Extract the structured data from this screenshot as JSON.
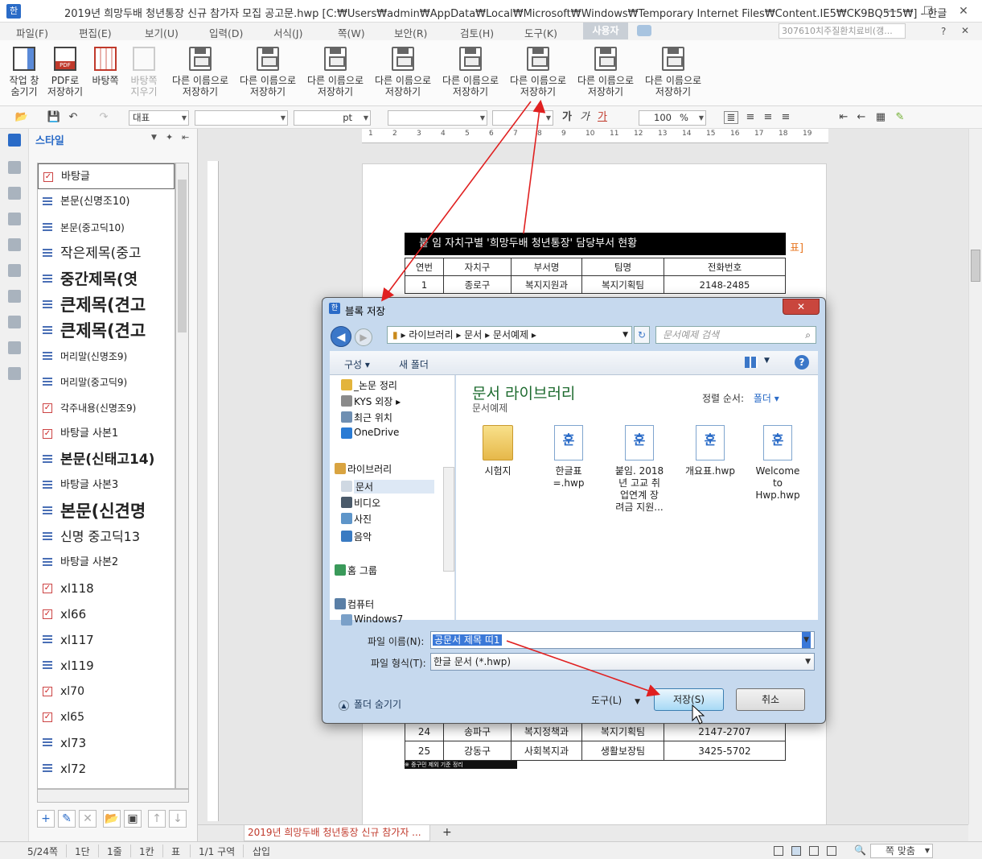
{
  "window": {
    "title": "2019년 희망두배 청년통장 신규 참가자 모집 공고문.hwp [C:₩Users₩admin₩AppData₩Local₩Microsoft₩Windows₩Temporary Internet Files₩Content.IE5₩CK9BQ515₩] - 한글",
    "minimize": "—",
    "maximize": "☐",
    "close": "✕"
  },
  "menu": {
    "items": [
      "파일(F)",
      "편집(E)",
      "보기(U)",
      "입력(D)",
      "서식(J)",
      "쪽(W)",
      "보안(R)",
      "검토(H)",
      "도구(K)"
    ],
    "user_tab": "사용자",
    "doc_combo": "307610치주질환치료비(갱...",
    "help": "?"
  },
  "ribbon": {
    "buttons": [
      "작업 창\n숨기기",
      "PDF로\n저장하기",
      "바탕쪽",
      "바탕쪽\n지우기",
      "다른 이름으로\n저장하기",
      "다른 이름으로\n저장하기",
      "다른 이름으로\n저장하기",
      "다른 이름으로\n저장하기",
      "다른 이름으로\n저장하기",
      "다른 이름으로\n저장하기",
      "다른 이름으로\n저장하기",
      "다른 이름으로\n저장하기"
    ]
  },
  "format_toolbar": {
    "style": "대표",
    "font": "",
    "size_unit": "pt",
    "zoom": "100",
    "zoom_unit": "%"
  },
  "style_panel": {
    "title": "스타일",
    "styles": [
      {
        "label": "바탕글",
        "icon": "mark"
      },
      {
        "label": "본문(신명조10)",
        "icon": "lines"
      },
      {
        "label": "본문(중고딕10)",
        "icon": "lines"
      },
      {
        "label": "작은제목(중고",
        "icon": "lines"
      },
      {
        "label": "중간제목(엿",
        "icon": "lines"
      },
      {
        "label": "큰제목(견고",
        "icon": "lines"
      },
      {
        "label": "큰제목(견고",
        "icon": "lines"
      },
      {
        "label": "머리말(신명조9)",
        "icon": "lines"
      },
      {
        "label": "머리말(중고딕9)",
        "icon": "lines"
      },
      {
        "label": "각주내용(신명조9)",
        "icon": "mark"
      },
      {
        "label": "바탕글 사본1",
        "icon": "mark"
      },
      {
        "label": "본문(신태고14)",
        "icon": "lines"
      },
      {
        "label": "바탕글 사본3",
        "icon": "lines"
      },
      {
        "label": "본문(신견명",
        "icon": "lines"
      },
      {
        "label": "신명 중고딕13",
        "icon": "lines"
      },
      {
        "label": "바탕글 사본2",
        "icon": "lines"
      },
      {
        "label": "xl118",
        "icon": "mark"
      },
      {
        "label": "xl66",
        "icon": "mark"
      },
      {
        "label": "xl117",
        "icon": "lines"
      },
      {
        "label": "xl119",
        "icon": "lines"
      },
      {
        "label": "xl70",
        "icon": "mark"
      },
      {
        "label": "xl65",
        "icon": "mark"
      },
      {
        "label": "xl73",
        "icon": "lines"
      },
      {
        "label": "xl72",
        "icon": "lines"
      }
    ]
  },
  "document": {
    "table_title": "붙 임  자치구별 '희망두배 청년통장' 담당부서 현황",
    "side_hint": "표]",
    "headers": [
      "연번",
      "자치구",
      "부서명",
      "팀명",
      "전화번호"
    ],
    "rows": [
      [
        "1",
        "종로구",
        "복지지원과",
        "복지기획팀",
        "2148-2485"
      ]
    ],
    "bottom_rows": [
      [
        "24",
        "송파구",
        "복지정책과",
        "복지기획팀",
        "2147-2707"
      ],
      [
        "25",
        "강동구",
        "사회복지과",
        "생활보장팀",
        "3425-5702"
      ]
    ],
    "footnote": "※ 중구민 제외 기준 정리"
  },
  "ruler": {
    "ticks": [
      "1",
      "2",
      "3",
      "4",
      "5",
      "6",
      "7",
      "8",
      "9",
      "10",
      "11",
      "12",
      "13",
      "14",
      "15",
      "16",
      "17",
      "18",
      "19"
    ]
  },
  "dialog": {
    "title": "블록 저장",
    "address": [
      "라이브러리",
      "문서",
      "문서예제"
    ],
    "search_placeholder": "문서예제 검색",
    "organize": "구성 ▾",
    "new_folder": "새 폴더",
    "nav_items": [
      {
        "label": "_논문 정리",
        "kind": "folder"
      },
      {
        "label": "KYS 외장 ▸",
        "kind": "drive"
      },
      {
        "label": "최근 위치",
        "kind": "recent"
      },
      {
        "label": "OneDrive",
        "kind": "cloud"
      },
      {
        "label": "라이브러리",
        "kind": "library"
      },
      {
        "label": "문서",
        "kind": "docs"
      },
      {
        "label": "비디오",
        "kind": "video"
      },
      {
        "label": "사진",
        "kind": "photo"
      },
      {
        "label": "음악",
        "kind": "music"
      },
      {
        "label": "홈 그룹",
        "kind": "home"
      },
      {
        "label": "컴퓨터",
        "kind": "pc"
      },
      {
        "label": "Windows7",
        "kind": "win"
      }
    ],
    "library_title": "문서 라이브러리",
    "library_sub": "문서예제",
    "sort_label": "정렬 순서:",
    "sort_value": "폴더 ▾",
    "files": [
      {
        "name": "시험지",
        "type": "folder"
      },
      {
        "name": "한글표\n=.hwp",
        "type": "hwp"
      },
      {
        "name": "붙임. 2018\n년 고교 취\n업연계 장\n려금 지원...",
        "type": "hwp"
      },
      {
        "name": "개요표.hwp",
        "type": "hwp"
      },
      {
        "name": "Welcome\nto\nHwp.hwp",
        "type": "hwp"
      }
    ],
    "filename_label": "파일 이름(N):",
    "filename_value": "공문서 제목 띠1",
    "filetype_label": "파일 형식(T):",
    "filetype_value": "한글 문서 (*.hwp)",
    "hide_folders": "폴더 숨기기",
    "tools": "도구(L)",
    "save": "저장(S)",
    "cancel": "취소"
  },
  "tabs": {
    "doc_tab": "2019년 희망두배 청년통장 신규 참가자 ...",
    "add": "+"
  },
  "status": {
    "page": "5/24쪽",
    "col": "1단",
    "line": "1줄",
    "char": "1칸",
    "table": "표",
    "section": "1/1 구역",
    "mode": "삽입",
    "zoom": "쪽 맞춤"
  },
  "colors": {
    "accent": "#2a6bc7",
    "arrow": "#e02020",
    "dialog_frame": "#c6d9ee",
    "library_title": "#1e6b2f"
  }
}
